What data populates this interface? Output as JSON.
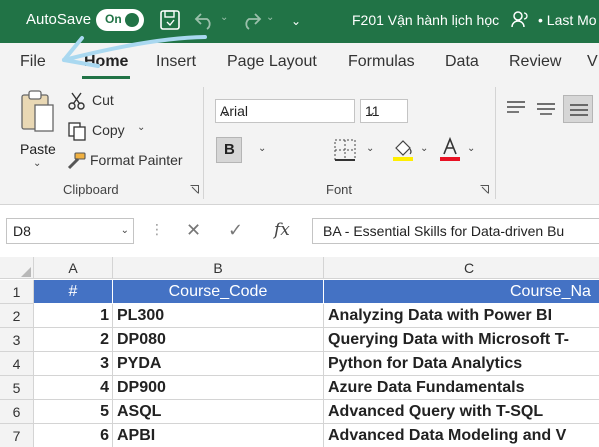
{
  "titlebar": {
    "autosave_label": "AutoSave",
    "autosave_state": "On",
    "document_title": "F201 Vận hành lịch học",
    "last_modified": "• Last Mo"
  },
  "tabs": [
    {
      "label": "File"
    },
    {
      "label": "Home",
      "active": true
    },
    {
      "label": "Insert"
    },
    {
      "label": "Page Layout"
    },
    {
      "label": "Formulas"
    },
    {
      "label": "Data"
    },
    {
      "label": "Review"
    },
    {
      "label": "V"
    }
  ],
  "clipboard": {
    "paste_label": "Paste",
    "cut_label": "Cut",
    "copy_label": "Copy",
    "format_painter_label": "Format Painter",
    "group_label": "Clipboard"
  },
  "font": {
    "family": "Arial",
    "size": "11",
    "group_label": "Font",
    "bold_label": "B",
    "font_color": "#e81123",
    "highlight_color": "#ffee00"
  },
  "formula_bar": {
    "name_box": "D8",
    "formula": "BA  - Essential Skills for Data-driven Bu"
  },
  "grid": {
    "columns": [
      "A",
      "B",
      "C"
    ],
    "header": {
      "row": "1",
      "a": "#",
      "b": "Course_Code",
      "c": "Course_Na"
    },
    "header_color": "#4472c4",
    "rows": [
      {
        "row": "2",
        "a": "1",
        "b": "PL300",
        "c": "Analyzing Data with Power BI"
      },
      {
        "row": "3",
        "a": "2",
        "b": "DP080",
        "c": "Querying Data with Microsoft T-"
      },
      {
        "row": "4",
        "a": "3",
        "b": "PYDA",
        "c": "Python for Data Analytics"
      },
      {
        "row": "5",
        "a": "4",
        "b": "DP900",
        "c": "Azure Data Fundamentals"
      },
      {
        "row": "6",
        "a": "5",
        "b": "ASQL",
        "c": "Advanced Query with T-SQL"
      },
      {
        "row": "7",
        "a": "6",
        "b": "APBI",
        "c": "Advanced Data Modeling and V"
      }
    ]
  }
}
